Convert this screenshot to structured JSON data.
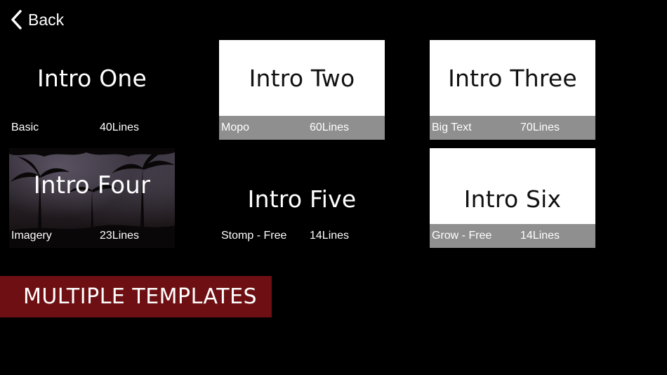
{
  "nav": {
    "back_label": "Back"
  },
  "templates": [
    {
      "title": "Intro One",
      "style": "Basic",
      "lines": "40Lines"
    },
    {
      "title": "Intro Two",
      "style": "Mopo",
      "lines": "60Lines"
    },
    {
      "title": "Intro Three",
      "style": "Big Text",
      "lines": "70Lines"
    },
    {
      "title": "Intro Four",
      "style": "Imagery",
      "lines": "23Lines"
    },
    {
      "title": "Intro Five",
      "style": "Stomp - Free",
      "lines": "14Lines"
    },
    {
      "title": "Intro Six",
      "style": "Grow - Free",
      "lines": "14Lines"
    }
  ],
  "banner": {
    "text": "MULTIPLE TEMPLATES"
  },
  "icons": {
    "back": "chevron-left-icon",
    "palm_background": "palm-trees-image"
  },
  "colors": {
    "background": "#000000",
    "card_light": "#ffffff",
    "card_footer": "#8f8f8f",
    "banner": "#6e1013"
  }
}
